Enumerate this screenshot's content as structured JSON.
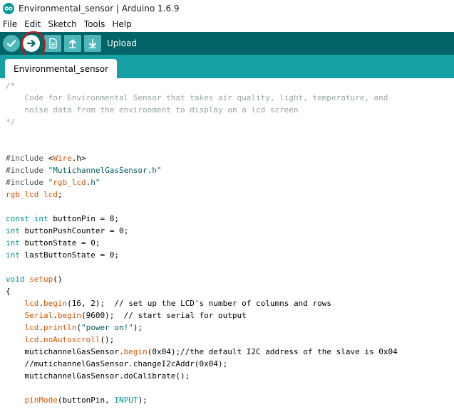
{
  "window": {
    "title": "Environmental_sensor | Arduino 1.6.9"
  },
  "menu": [
    "File",
    "Edit",
    "Sketch",
    "Tools",
    "Help"
  ],
  "toolbar": {
    "hover_label": "Upload",
    "buttons": [
      {
        "name": "verify",
        "icon": "check-icon"
      },
      {
        "name": "upload",
        "icon": "arrow-right-icon"
      },
      {
        "name": "new",
        "icon": "document-icon"
      },
      {
        "name": "open",
        "icon": "arrow-up-icon"
      },
      {
        "name": "save",
        "icon": "arrow-down-icon"
      }
    ]
  },
  "tabs": [
    {
      "label": "Environmental_sensor",
      "active": true
    }
  ],
  "colors": {
    "toolbar_bg": "#006468",
    "tabstrip_bg": "#17a1a5",
    "button_bg": "#4db7bb",
    "highlight_ring": "#e01010"
  },
  "code": [
    "/*",
    "    Code for Environmental Sensor that takes air quality, light, temperature, and",
    "    noise data from the environment to display on a lcd screen",
    "*/",
    "",
    "",
    "#include <Wire.h>",
    "#include \"MutichannelGasSensor.h\"",
    "#include \"rgb_lcd.h\"",
    "rgb_lcd lcd;",
    "",
    "const int buttonPin = 8;",
    "int buttonPushCounter = 0;",
    "int buttonState = 0;",
    "int lastButtonState = 0;",
    "",
    "void setup()",
    "{",
    "    lcd.begin(16, 2);  // set up the LCD's number of columns and rows",
    "    Serial.begin(9600);  // start serial for output",
    "    lcd.println(\"power on!\");",
    "    lcd.noAutoscroll();",
    "    mutichannelGasSensor.begin(0x04);//the default I2C address of the slave is 0x04",
    "    //mutichannelGasSensor.changeI2cAddr(0x04);",
    "    mutichannelGasSensor.doCalibrate();",
    "",
    "    pinMode(buttonPin, INPUT);"
  ]
}
